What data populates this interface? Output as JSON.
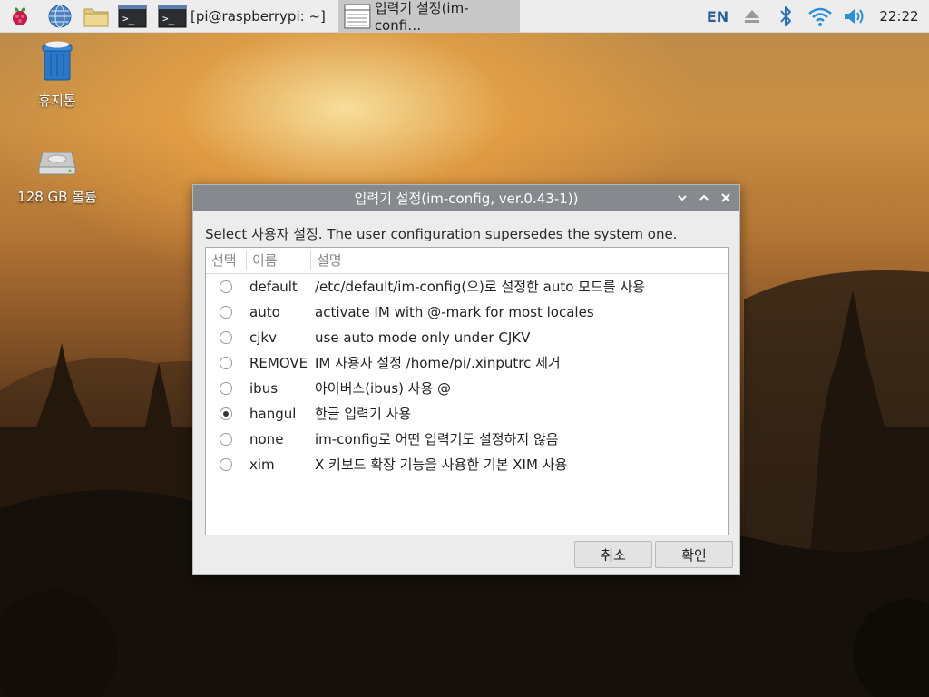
{
  "taskbar": {
    "launchers": [
      {
        "name": "raspberry-menu",
        "icon": "raspberry-icon"
      },
      {
        "name": "browser",
        "icon": "globe-icon"
      },
      {
        "name": "file-manager",
        "icon": "folder-icon"
      },
      {
        "name": "terminal",
        "icon": "terminal-icon"
      }
    ],
    "tasks": [
      {
        "label": "[pi@raspberrypi: ~]",
        "icon": "terminal-icon"
      },
      {
        "label": "입력기 설정(im-confi…",
        "icon": "window-icon",
        "active": true
      }
    ],
    "tray": {
      "lang": "EN",
      "clock": "22:22",
      "icons": [
        "eject-icon",
        "bluetooth-icon",
        "wifi-icon",
        "volume-icon"
      ]
    }
  },
  "desktop": {
    "icons": [
      {
        "label": "휴지통",
        "icon": "trash-icon"
      },
      {
        "label": "128 GB 볼륨",
        "icon": "drive-icon"
      }
    ]
  },
  "dialog": {
    "title": "입력기 설정(im-config, ver.0.43-1))",
    "description": "Select 사용자 설정. The user configuration supersedes the system one.",
    "columns": [
      "선택",
      "이름",
      "설명"
    ],
    "rows": [
      {
        "name": "default",
        "desc": "/etc/default/im-config(으)로 설정한 auto 모드를 사용",
        "selected": false
      },
      {
        "name": "auto",
        "desc": "activate IM with @-mark for most locales",
        "selected": false
      },
      {
        "name": "cjkv",
        "desc": "use auto mode only under CJKV",
        "selected": false
      },
      {
        "name": "REMOVE",
        "desc": "IM 사용자 설정 /home/pi/.xinputrc 제거",
        "selected": false
      },
      {
        "name": "ibus",
        "desc": "아이버스(ibus) 사용 @",
        "selected": false
      },
      {
        "name": "hangul",
        "desc": "한글 입력기 사용",
        "selected": true
      },
      {
        "name": "none",
        "desc": "im-config로 어떤 입력기도 설정하지 않음",
        "selected": false
      },
      {
        "name": "xim",
        "desc": "X 키보드 확장 기능을 사용한 기본 XIM 사용",
        "selected": false
      }
    ],
    "cancel_label": "취소",
    "ok_label": "확인"
  },
  "colors": {
    "panel_bg": "#ededed",
    "titlebar_bg": "#868a8e",
    "accent_blue": "#2b5f96"
  }
}
